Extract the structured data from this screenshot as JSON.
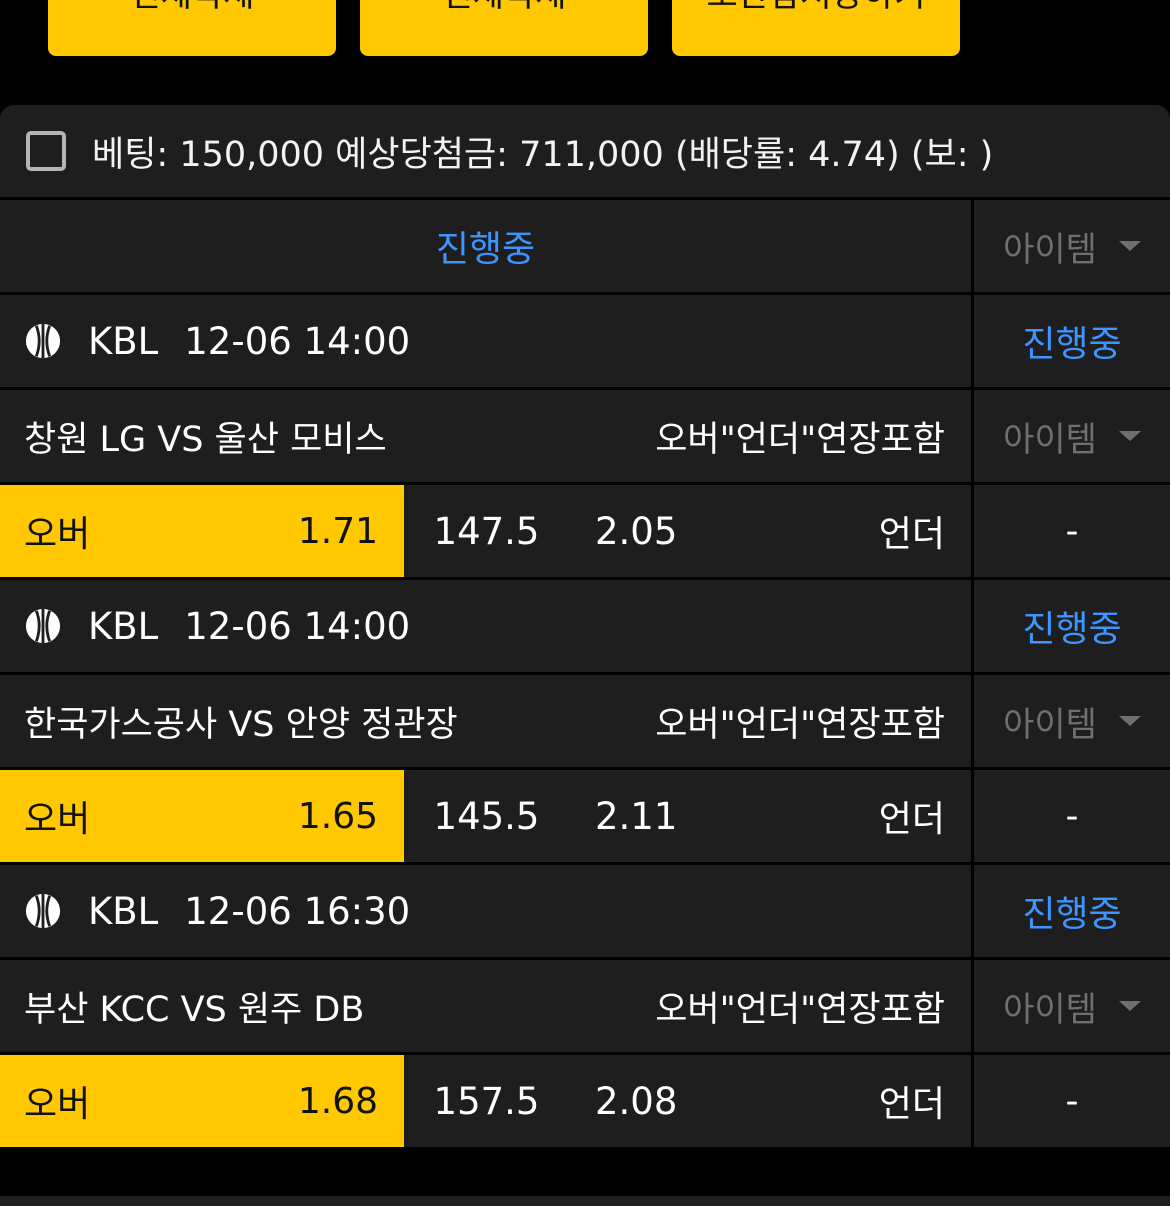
{
  "top_buttons": [
    "전체삭제",
    "전체삭제",
    "보관함저장하기"
  ],
  "summary": {
    "text": "베팅: 150,000 예상당첨금: 711,000 (배당률: 4.74) (보: )"
  },
  "header": {
    "status": "진행중",
    "item": "아이템"
  },
  "games": [
    {
      "league": "KBL",
      "datetime": "12-06 14:00",
      "status": "진행중",
      "match": "창원 LG VS 울산 모비스",
      "market": "오버\"언더\"연장포함",
      "item": "아이템",
      "over_label": "오버",
      "over_odds": "1.71",
      "handicap": "147.5",
      "under_odds": "2.05",
      "under_label": "언더",
      "dash": "-"
    },
    {
      "league": "KBL",
      "datetime": "12-06 14:00",
      "status": "진행중",
      "match": "한국가스공사 VS 안양 정관장",
      "market": "오버\"언더\"연장포함",
      "item": "아이템",
      "over_label": "오버",
      "over_odds": "1.65",
      "handicap": "145.5",
      "under_odds": "2.11",
      "under_label": "언더",
      "dash": "-"
    },
    {
      "league": "KBL",
      "datetime": "12-06 16:30",
      "status": "진행중",
      "match": "부산 KCC VS 원주 DB",
      "market": "오버\"언더\"연장포함",
      "item": "아이템",
      "over_label": "오버",
      "over_odds": "1.68",
      "handicap": "157.5",
      "under_odds": "2.08",
      "under_label": "언더",
      "dash": "-"
    }
  ],
  "colors": {
    "accent_yellow": "#ffc800",
    "status_blue": "#3d95ff",
    "panel_bg": "#1e1e1e",
    "muted_gray": "#6f6f6f"
  },
  "icons": {
    "league": "basketball-icon",
    "checkbox": "checkbox-empty",
    "dropdown": "caret-down-icon"
  }
}
